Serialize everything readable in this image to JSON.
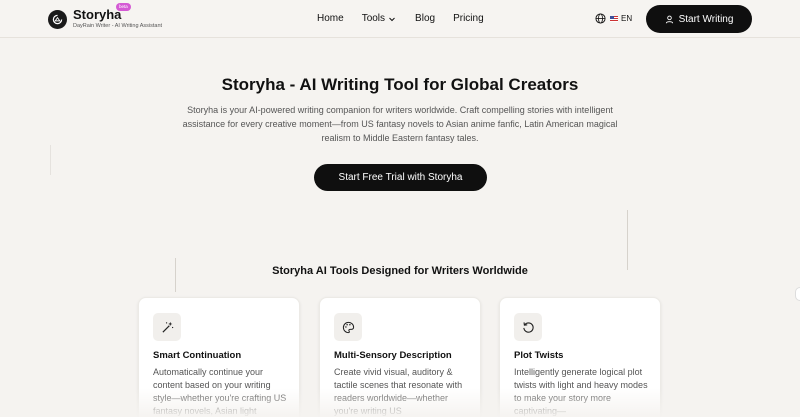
{
  "brand": {
    "name": "Storyha",
    "badge": "beta",
    "tagline": "DayRain Writer - AI Writing Assistant"
  },
  "nav": {
    "links": [
      "Home",
      "Tools",
      "Blog",
      "Pricing"
    ],
    "language": "EN",
    "cta": "Start Writing"
  },
  "hero": {
    "title": "Storyha - AI Writing Tool for Global Creators",
    "description": "Storyha is your AI-powered writing companion for writers worldwide. Craft compelling stories with intelligent assistance for every creative moment—from US fantasy novels to Asian anime fanfic, Latin American magical realism to Middle Eastern fantasy tales.",
    "cta": "Start Free Trial with Storyha"
  },
  "tools": {
    "title": "Storyha AI Tools Designed for Writers Worldwide",
    "cards": [
      {
        "icon": "magic-wand-icon",
        "title": "Smart Continuation",
        "description": "Automatically continue your content based on your writing style—whether you're crafting US fantasy novels, Asian light"
      },
      {
        "icon": "palette-icon",
        "title": "Multi-Sensory Description",
        "description": "Create vivid visual, auditory & tactile scenes that resonate with readers worldwide—whether you're writing US"
      },
      {
        "icon": "rotate-icon",
        "title": "Plot Twists",
        "description": "Intelligently generate logical plot twists with light and heavy modes to make your story more captivating—"
      }
    ]
  }
}
